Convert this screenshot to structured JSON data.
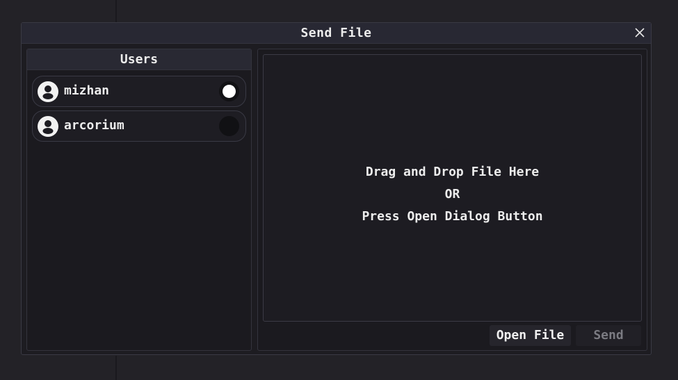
{
  "window": {
    "title": "Send File"
  },
  "users_panel": {
    "header": "Users",
    "users": [
      {
        "name": "mizhan",
        "online": true
      },
      {
        "name": "arcorium",
        "online": false
      }
    ]
  },
  "drop_zone": {
    "line1": "Drag and Drop File Here",
    "line2": "OR",
    "line3": "Press Open Dialog Button"
  },
  "buttons": {
    "open_file": "Open File",
    "send": "Send",
    "send_enabled": false
  },
  "icons": {
    "close": "close-icon",
    "avatar": "user-icon"
  },
  "colors": {
    "background": "#232227",
    "panel": "#1b1a1f",
    "header": "#292933",
    "text": "#ececec",
    "disabled_text": "#7b7b82"
  }
}
